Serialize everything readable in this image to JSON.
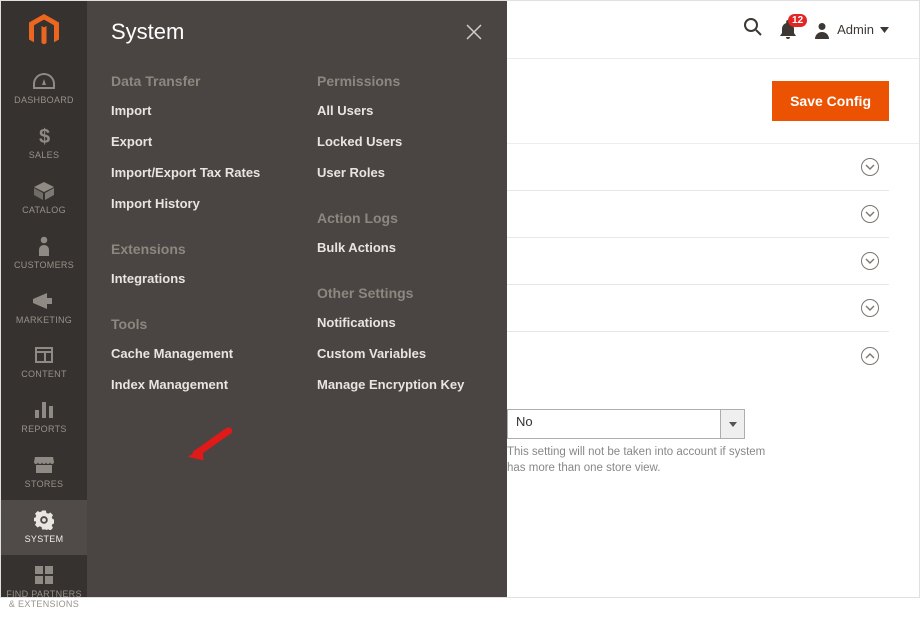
{
  "sidebar": {
    "items": [
      {
        "label": "DASHBOARD"
      },
      {
        "label": "SALES"
      },
      {
        "label": "CATALOG"
      },
      {
        "label": "CUSTOMERS"
      },
      {
        "label": "MARKETING"
      },
      {
        "label": "CONTENT"
      },
      {
        "label": "REPORTS"
      },
      {
        "label": "STORES"
      },
      {
        "label": "SYSTEM"
      },
      {
        "label": "FIND PARTNERS\n& EXTENSIONS"
      }
    ]
  },
  "flyout": {
    "title": "System",
    "col1": [
      {
        "title": "Data Transfer",
        "items": [
          "Import",
          "Export",
          "Import/Export Tax Rates",
          "Import History"
        ]
      },
      {
        "title": "Extensions",
        "items": [
          "Integrations"
        ]
      },
      {
        "title": "Tools",
        "items": [
          "Cache Management",
          "Index Management"
        ]
      }
    ],
    "col2": [
      {
        "title": "Permissions",
        "items": [
          "All Users",
          "Locked Users",
          "User Roles"
        ]
      },
      {
        "title": "Action Logs",
        "items": [
          "Bulk Actions"
        ]
      },
      {
        "title": "Other Settings",
        "items": [
          "Notifications",
          "Custom Variables",
          "Manage Encryption Key"
        ]
      }
    ]
  },
  "top": {
    "badge": "12",
    "user": "Admin"
  },
  "buttons": {
    "save": "Save Config"
  },
  "field": {
    "value": "No",
    "help": "This setting will not be taken into account if system has more than one store view."
  }
}
